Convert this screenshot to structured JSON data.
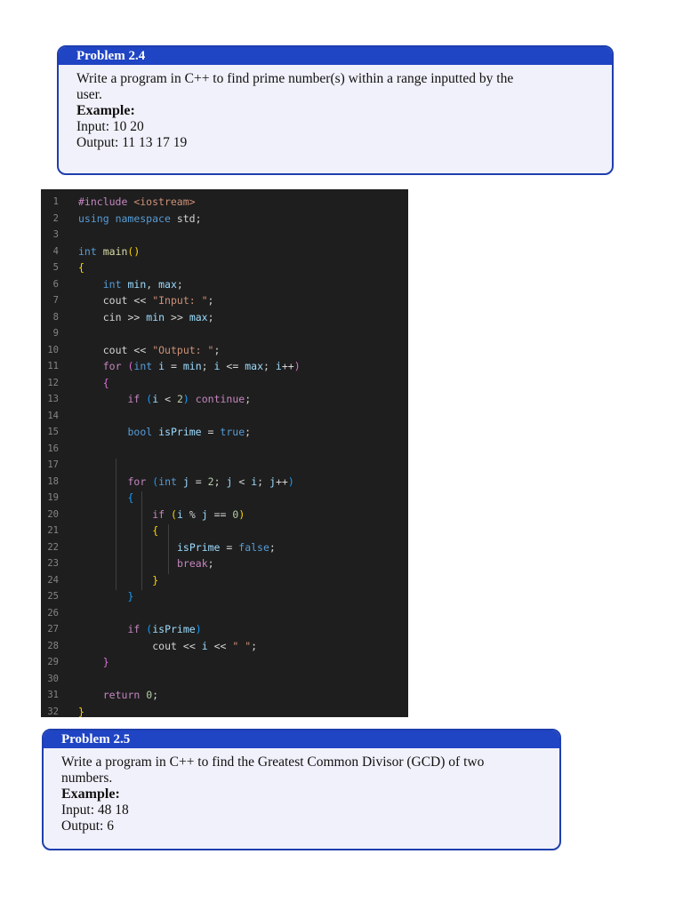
{
  "problem_2_4": {
    "title": "Problem 2.4",
    "desc_line1": "Write a program in C++ to find prime number(s) within a range inputted by the",
    "desc_line2": "user.",
    "example_label": "Example:",
    "input": "Input: 10 20",
    "output": "Output: 11 13 17 19"
  },
  "code": {
    "lines": [
      {
        "n": "1",
        "t": "#include <iostream>"
      },
      {
        "n": "2",
        "t": "using namespace std;"
      },
      {
        "n": "3",
        "t": ""
      },
      {
        "n": "4",
        "t": "int main()"
      },
      {
        "n": "5",
        "t": "{"
      },
      {
        "n": "6",
        "t": "    int min, max;"
      },
      {
        "n": "7",
        "t": "    cout << \"Input: \";"
      },
      {
        "n": "8",
        "t": "    cin >> min >> max;"
      },
      {
        "n": "9",
        "t": ""
      },
      {
        "n": "10",
        "t": "    cout << \"Output: \";"
      },
      {
        "n": "11",
        "t": "    for (int i = min; i <= max; i++)"
      },
      {
        "n": "12",
        "t": "    {"
      },
      {
        "n": "13",
        "t": "        if (i < 2) continue;"
      },
      {
        "n": "14",
        "t": ""
      },
      {
        "n": "15",
        "t": "        bool isPrime = true;"
      },
      {
        "n": "16",
        "t": ""
      },
      {
        "n": "17",
        "t": ""
      },
      {
        "n": "18",
        "t": "        for (int j = 2; j < i; j++)"
      },
      {
        "n": "19",
        "t": "        {"
      },
      {
        "n": "20",
        "t": "            if (i % j == 0)"
      },
      {
        "n": "21",
        "t": "            {"
      },
      {
        "n": "22",
        "t": "                isPrime = false;"
      },
      {
        "n": "23",
        "t": "                break;"
      },
      {
        "n": "24",
        "t": "            }"
      },
      {
        "n": "25",
        "t": "        }"
      },
      {
        "n": "26",
        "t": ""
      },
      {
        "n": "27",
        "t": "        if (isPrime)"
      },
      {
        "n": "28",
        "t": "            cout << i << \" \";"
      },
      {
        "n": "29",
        "t": "    }"
      },
      {
        "n": "30",
        "t": ""
      },
      {
        "n": "31",
        "t": "    return 0;"
      },
      {
        "n": "32",
        "t": "}"
      }
    ]
  },
  "problem_2_5": {
    "title": "Problem 2.5",
    "desc_line1": "Write a program in C++ to find the Greatest Common Divisor (GCD) of two",
    "desc_line2": "numbers.",
    "example_label": "Example:",
    "input": "Input: 48 18",
    "output": "Output: 6"
  }
}
